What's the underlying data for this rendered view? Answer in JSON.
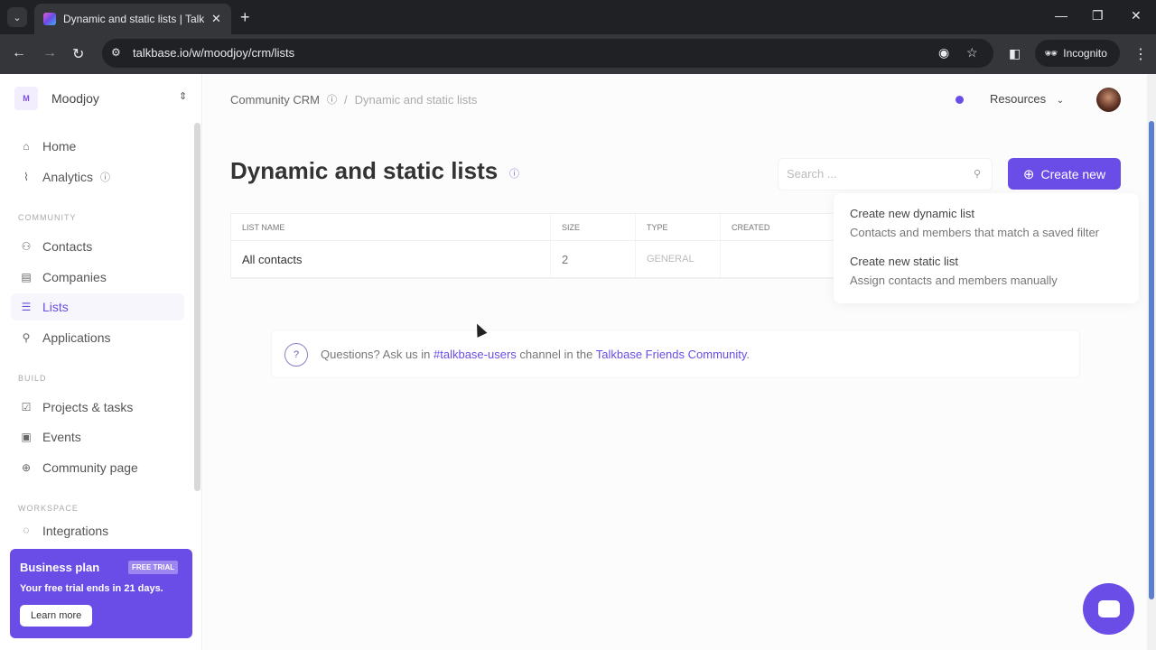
{
  "browser": {
    "tab_title": "Dynamic and static lists | Talkbase",
    "url": "talkbase.io/w/moodjoy/crm/lists",
    "incognito_label": "Incognito",
    "new_tab": "+",
    "tab_close": "✕"
  },
  "sidebar": {
    "workspace_initial": "M",
    "workspace_name": "Moodjoy",
    "top_items": [
      {
        "label": "Home",
        "icon": "home-icon"
      },
      {
        "label": "Analytics",
        "icon": "chart-icon"
      }
    ],
    "sections": [
      {
        "title": "COMMUNITY",
        "items": [
          {
            "label": "Contacts",
            "icon": "users-icon"
          },
          {
            "label": "Companies",
            "icon": "building-icon"
          },
          {
            "label": "Lists",
            "icon": "list-icon",
            "active": true
          },
          {
            "label": "Applications",
            "icon": "user-plus-icon"
          }
        ]
      },
      {
        "title": "BUILD",
        "items": [
          {
            "label": "Projects & tasks",
            "icon": "task-icon"
          },
          {
            "label": "Events",
            "icon": "calendar-icon"
          },
          {
            "label": "Community page",
            "icon": "globe-icon"
          }
        ]
      },
      {
        "title": "WORKSPACE",
        "items": [
          {
            "label": "Integrations",
            "icon": "integrations-icon"
          }
        ]
      }
    ],
    "plan": {
      "title": "Business plan",
      "badge": "FREE TRIAL",
      "text": "Your free trial ends in 21 days.",
      "button": "Learn more"
    }
  },
  "header": {
    "breadcrumb_root": "Community CRM",
    "breadcrumb_sep": "/",
    "breadcrumb_current": "Dynamic and static lists",
    "resources_label": "Resources"
  },
  "page": {
    "title": "Dynamic and static lists",
    "search_placeholder": "Search ...",
    "search_value": "",
    "create_button": "Create new"
  },
  "table": {
    "columns": [
      "LIST NAME",
      "SIZE",
      "TYPE",
      "CREATED"
    ],
    "rows": [
      {
        "name": "All contacts",
        "size": "2",
        "type": "GENERAL",
        "created": ""
      }
    ]
  },
  "create_menu": {
    "items": [
      {
        "title": "Create new dynamic list",
        "description": "Contacts and members that match a saved filter"
      },
      {
        "title": "Create new static list",
        "description": "Assign contacts and members manually"
      }
    ]
  },
  "help": {
    "prefix": "Questions? Ask us in ",
    "channel": "#talkbase-users",
    "middle": " channel in the ",
    "community": "Talkbase Friends Community",
    "suffix": "."
  },
  "colors": {
    "accent": "#6a4ce6"
  }
}
